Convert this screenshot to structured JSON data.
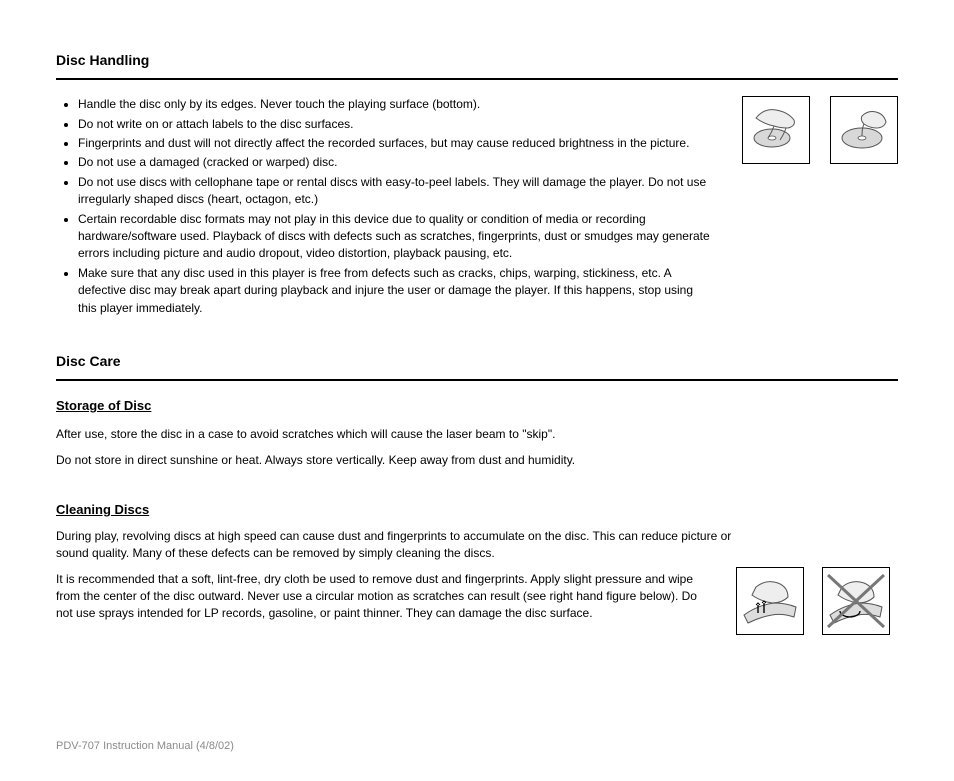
{
  "handling": {
    "title": "Disc Handling",
    "bullets": [
      "Handle the disc only by its edges.  Never touch the playing surface (bottom).",
      "Do not write on or attach labels to the disc surfaces.",
      "Fingerprints and dust will not directly affect the recorded surfaces, but may cause reduced brightness in the picture.",
      "Do not use a damaged (cracked or warped) disc.",
      "Do not use discs with cellophane tape or rental discs with easy-to-peel labels.  They will damage the player.  Do not use irregularly shaped discs (heart, octagon, etc.)",
      "Certain recordable disc formats may not play in this device due to quality or condition of media or recording hardware/software used.  Playback of discs with defects such as scratches, fingerprints, dust or smudges may generate errors including picture and audio dropout, video distortion, playback pausing, etc.",
      "Make sure that any disc used in this player is free from defects such as cracks, chips, warping, stickiness, etc.  A defective disc may break apart during playback and injure the user or damage the player.  If this happens, stop using this player immediately."
    ]
  },
  "care": {
    "title": "Disc Care",
    "storage": {
      "label": "Storage of Disc",
      "paragraphs": [
        "After use, store the disc in a case to avoid scratches which will cause the laser beam to \"skip\".",
        "Do not store in direct sunshine or heat.  Always store vertically.  Keep away from dust and humidity."
      ]
    },
    "cleaning": {
      "label": "Cleaning Discs",
      "para1": "During play, revolving discs at high speed can cause dust and fingerprints to accumulate on the disc.  This can reduce picture or sound quality.  Many of these defects can be removed by simply cleaning the discs.",
      "para2": "It is recommended that a soft, lint-free, dry cloth be used to remove dust and fingerprints.  Apply slight pressure and wipe from the center of the disc outward.  Never use a circular motion as scratches can result (see right hand figure below).  Do not use sprays intended for LP records, gasoline, or paint thinner.  They can damage the disc surface."
    }
  },
  "footer": "PDV-707 Instruction Manual (4/8/02)"
}
